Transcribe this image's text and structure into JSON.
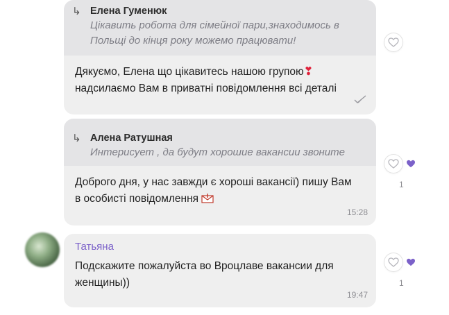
{
  "messages": [
    {
      "quote": {
        "author": "Елена Гуменюк",
        "text": "Цікавить робота для сімейної пари,знаходимось в Польщі до кінця року можемо працювати!"
      },
      "text_line1": "Дякуємо, Елена що цікавитесь нашою групою",
      "text_line2": "надсилаємо Вам в приватні повідомлення всі деталі",
      "emoji_icon": "heart-exclamation-icon",
      "status_icon": "read-check-icon"
    },
    {
      "quote": {
        "author": "Алена Ратушная",
        "text": "Интерисует , да будут хорошие вакансии звоните"
      },
      "text_line1": "Доброго дня, у нас завжди є хороші вакансії) пишу Вам",
      "text_line2": "в особисті повідомлення",
      "emoji_icon": "envelope-icon",
      "time": "15:28",
      "like_count": "1"
    },
    {
      "sender": "Татьяна",
      "text_line1": "Подскажите пожалуйста во Вроцлаве вакансии для",
      "text_line2": "женщины))",
      "time": "19:47",
      "like_count": "1"
    }
  ],
  "colors": {
    "bubble": "#efefef",
    "quote_bg": "#e4e4e6",
    "sender_name": "#7b61c9",
    "like_heart": "#7b61c9"
  }
}
